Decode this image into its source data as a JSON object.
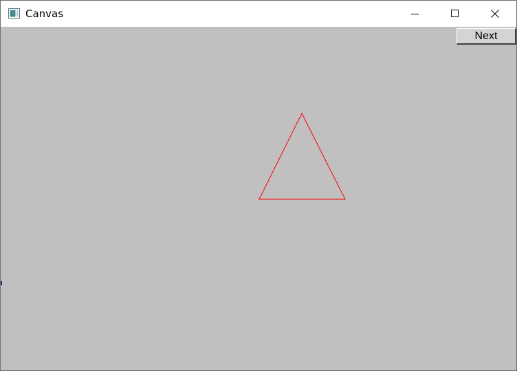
{
  "window": {
    "title": "Canvas",
    "icon": "canvas-app-icon",
    "controls": {
      "minimize_icon": "minimize-icon",
      "maximize_icon": "maximize-icon",
      "close_icon": "close-icon"
    }
  },
  "canvas": {
    "background_color": "#c0c0c0",
    "next_button_label": "Next",
    "shape": {
      "kind": "triangle-outline",
      "stroke_color": "#ff0000"
    }
  }
}
